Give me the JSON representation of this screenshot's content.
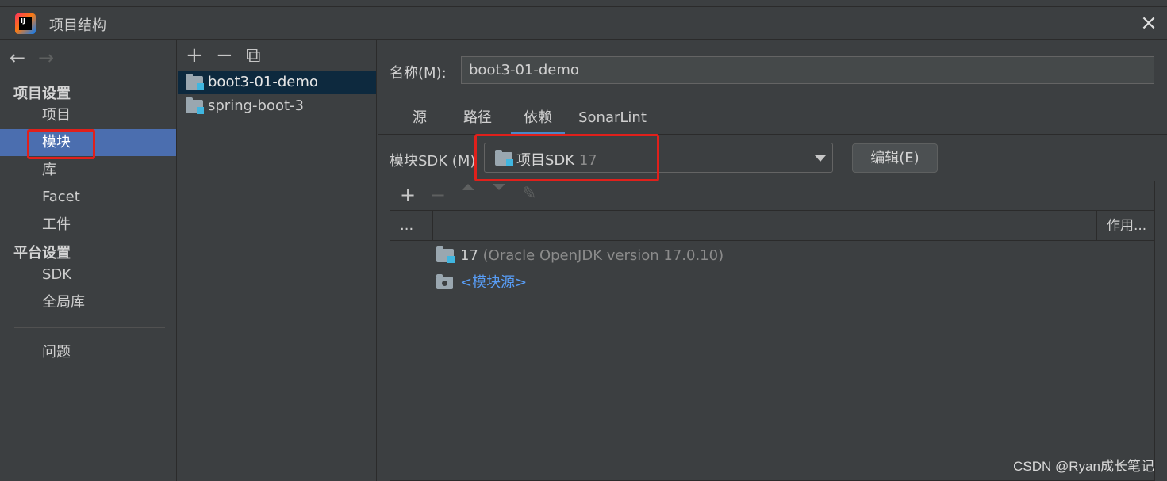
{
  "window": {
    "title": "项目结构",
    "logo_text": "IJ",
    "close_icon": "×"
  },
  "sidebar": {
    "back": "←",
    "forward": "→",
    "project_settings_title": "项目设置",
    "items": [
      "项目",
      "模块",
      "库",
      "Facet",
      "工件"
    ],
    "platform_settings_title": "平台设置",
    "platform_items": [
      "SDK",
      "全局库"
    ],
    "problems": "问题",
    "selected": "模块"
  },
  "modules": {
    "toolbar": {
      "add": "+",
      "remove": "−",
      "copy": "⧉"
    },
    "items": [
      "boot3-01-demo",
      "spring-boot-3"
    ],
    "selected": "boot3-01-demo"
  },
  "main": {
    "name_label": "名称(M):",
    "name_value": "boot3-01-demo",
    "tabs": [
      "源",
      "路径",
      "依赖",
      "SonarLint"
    ],
    "active_tab": "依赖",
    "sdk_label": "模块SDK (M)",
    "sdk_name": "项目SDK",
    "sdk_version": "17",
    "edit_button": "编辑(E)",
    "dep_toolbar": {
      "add": "+",
      "remove": "−",
      "edit": "✎"
    },
    "columns": {
      "first": "...",
      "scope": "作用..."
    },
    "dependencies": [
      {
        "name": "17",
        "detail": "(Oracle OpenJDK version 17.0.10)"
      },
      {
        "name": "<模块源>"
      }
    ]
  },
  "colors": {
    "highlight": "#e0201b",
    "selection": "#4b6eaf",
    "link": "#589df6"
  },
  "watermark": "CSDN @Ryan成长笔记"
}
